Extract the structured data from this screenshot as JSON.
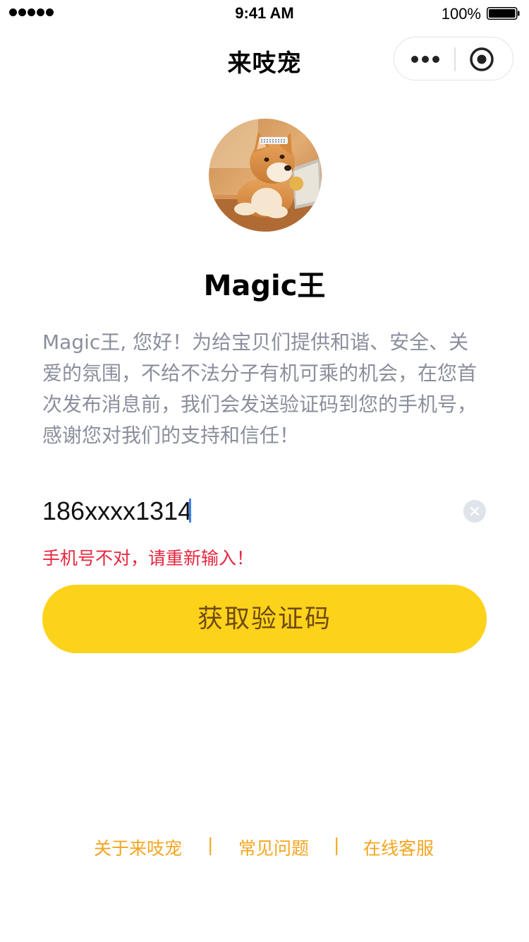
{
  "status_bar": {
    "time": "9:41 AM",
    "battery_percent": "100%",
    "battery_level": 1.0,
    "signal_bars": 5
  },
  "nav": {
    "title": "来吱宠",
    "more_icon": "more-dots-icon",
    "close_icon": "target-circle-icon"
  },
  "profile": {
    "avatar_icon": "shiba-dog-avatar",
    "name": "Magic王"
  },
  "intro": {
    "text": "Magic王, 您好！为给宝贝们提供和谐、安全、关爱的氛围，不给不法分子有机可乘的机会，在您首次发布消息前，我们会发送验证码到您的手机号，感谢您对我们的支持和信任！"
  },
  "phone": {
    "value": "186xxxx1314",
    "clear_icon": "clear-x-icon"
  },
  "error": {
    "message": "手机号不对，请重新输入！"
  },
  "actions": {
    "get_code_label": "获取验证码"
  },
  "footer": {
    "links": [
      "关于来吱宠",
      "常见问题",
      "在线客服"
    ],
    "separator": "|"
  },
  "colors": {
    "accent_yellow": "#fdd21b",
    "button_text": "#6e4b10",
    "link_orange": "#f5a51e",
    "error_red": "#e8253e",
    "intro_gray": "#8a8f9c"
  }
}
